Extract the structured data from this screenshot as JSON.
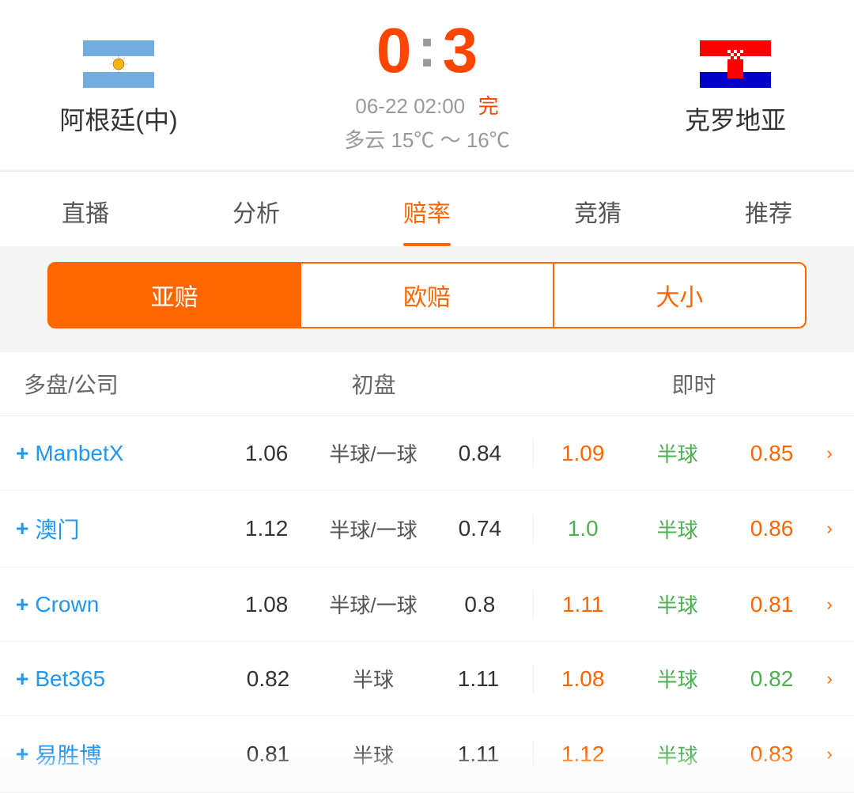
{
  "header": {
    "team_left": {
      "name": "阿根廷(中)",
      "score": "0"
    },
    "team_right": {
      "name": "克罗地亚",
      "score": "3"
    },
    "colon": ":",
    "datetime": "06-22 02:00",
    "status": "完",
    "weather": "多云  15℃ ～ 16℃"
  },
  "nav_tabs": [
    {
      "label": "直播",
      "active": false
    },
    {
      "label": "分析",
      "active": false
    },
    {
      "label": "赔率",
      "active": true
    },
    {
      "label": "竞猜",
      "active": false
    },
    {
      "label": "推荐",
      "active": false
    }
  ],
  "sub_tabs": [
    {
      "label": "亚赔",
      "active": true
    },
    {
      "label": "欧赔",
      "active": false
    },
    {
      "label": "大小",
      "active": false
    }
  ],
  "table": {
    "headers": [
      "多盘/公司",
      "初盘",
      "即时"
    ],
    "rows": [
      {
        "company": "ManbetX",
        "initial_left": "1.06",
        "initial_mid": "半球/一球",
        "initial_right": "0.84",
        "live_left": "1.09",
        "live_mid": "半球",
        "live_right": "0.85",
        "live_left_color": "orange",
        "live_right_color": "orange"
      },
      {
        "company": "澳门",
        "initial_left": "1.12",
        "initial_mid": "半球/一球",
        "initial_right": "0.74",
        "live_left": "1.0",
        "live_mid": "半球",
        "live_right": "0.86",
        "live_left_color": "green",
        "live_right_color": "orange"
      },
      {
        "company": "Crown",
        "initial_left": "1.08",
        "initial_mid": "半球/一球",
        "initial_right": "0.8",
        "live_left": "1.11",
        "live_mid": "半球",
        "live_right": "0.81",
        "live_left_color": "orange",
        "live_right_color": "orange"
      },
      {
        "company": "Bet365",
        "initial_left": "0.82",
        "initial_mid": "半球",
        "initial_right": "1.11",
        "live_left": "1.08",
        "live_mid": "半球",
        "live_right": "0.82",
        "live_left_color": "orange",
        "live_right_color": "green"
      },
      {
        "company": "易胜博",
        "initial_left": "0.81",
        "initial_mid": "半球",
        "initial_right": "1.11",
        "live_left": "1.12",
        "live_mid": "半球",
        "live_right": "0.83",
        "live_left_color": "orange",
        "live_right_color": "orange"
      }
    ]
  }
}
